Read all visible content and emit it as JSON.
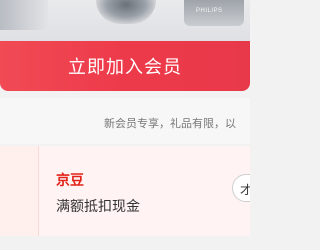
{
  "top_image": {
    "brand": "PHILIPS"
  },
  "join_button": {
    "label": "立即加入会员",
    "color": "#ed3a4a"
  },
  "notice": {
    "text": "新会员专享，礼品有限，以"
  },
  "coupon": {
    "name": "京豆",
    "description": "满额抵扣现金",
    "action_label": "才",
    "accent_color": "#e2231a"
  }
}
